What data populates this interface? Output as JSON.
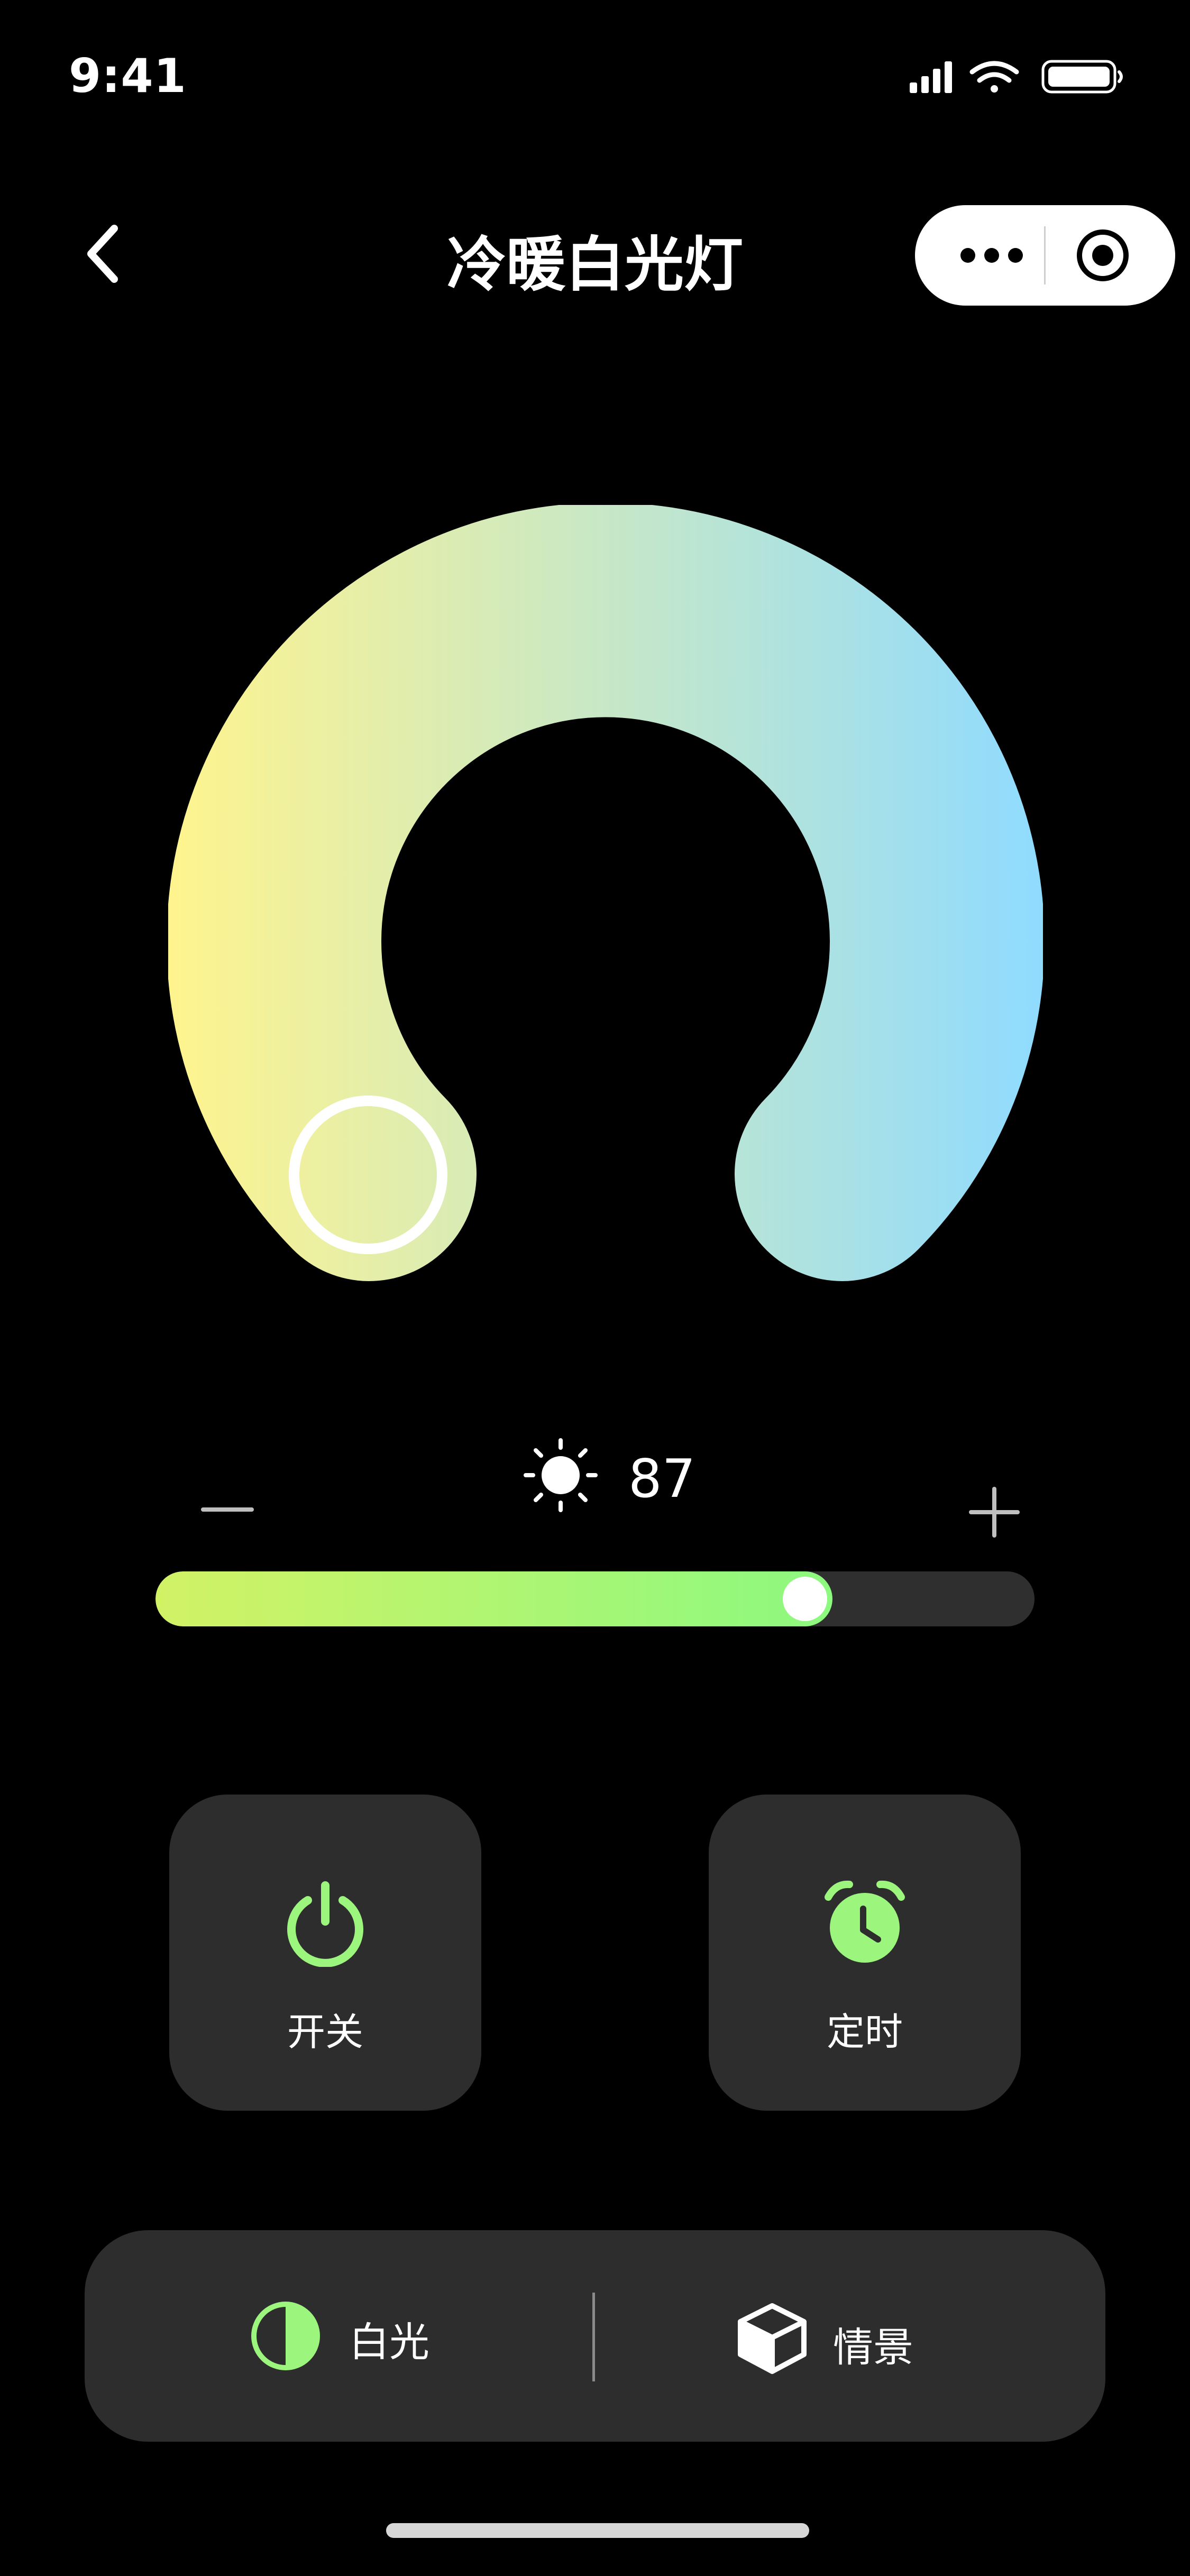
{
  "status_bar": {
    "time": "9:41"
  },
  "nav": {
    "title": "冷暖白光灯"
  },
  "color_temperature": {
    "warm_color": "#FFF48E",
    "cool_color": "#8FDBFF",
    "selected_position": 0.0
  },
  "brightness": {
    "value": "87",
    "level_fraction": 0.77,
    "fill_start_color": "#D2F265",
    "fill_end_color": "#8CF97F"
  },
  "controls": {
    "power_label": "开关",
    "timer_label": "定时",
    "accent_color": "#9CF57C"
  },
  "modes": {
    "white_label": "白光",
    "scene_label": "情景"
  },
  "icons": [
    "back-icon",
    "more-icon",
    "target-icon",
    "sun-icon",
    "minus-icon",
    "plus-icon",
    "power-icon",
    "alarm-clock-icon",
    "half-circle-icon",
    "cube-icon",
    "signal-icon",
    "wifi-icon",
    "battery-icon"
  ]
}
